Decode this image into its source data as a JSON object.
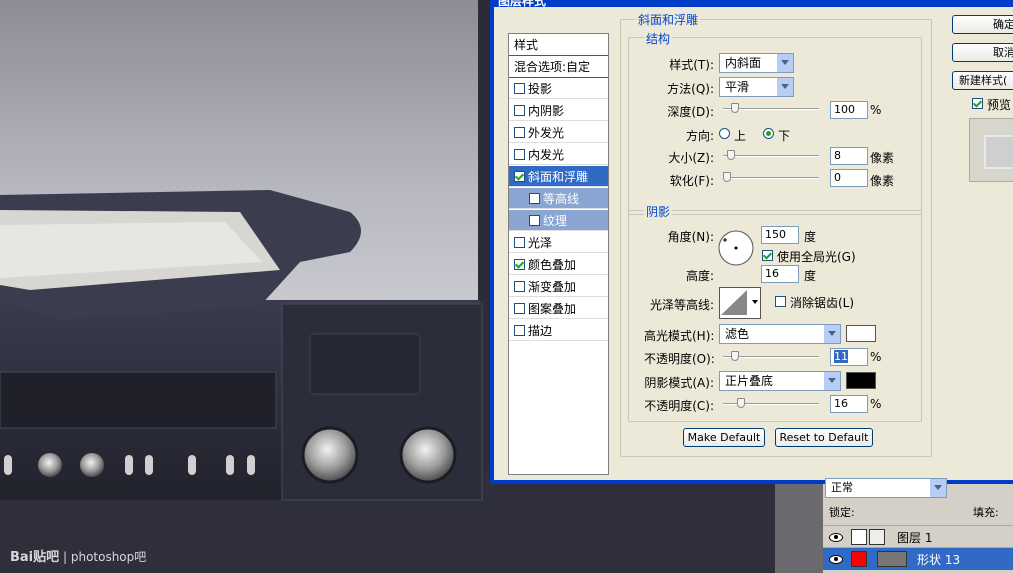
{
  "dialog": {
    "title": "图层样式",
    "list": {
      "header": "样式",
      "blend": "混合选项:自定",
      "items": [
        {
          "label": "投影",
          "checked": false
        },
        {
          "label": "内阴影",
          "checked": false
        },
        {
          "label": "外发光",
          "checked": false
        },
        {
          "label": "内发光",
          "checked": false
        },
        {
          "label": "斜面和浮雕",
          "checked": true
        },
        {
          "label": "等高线",
          "checked": false
        },
        {
          "label": "纹理",
          "checked": false
        },
        {
          "label": "光泽",
          "checked": false
        },
        {
          "label": "颜色叠加",
          "checked": true
        },
        {
          "label": "渐变叠加",
          "checked": false
        },
        {
          "label": "图案叠加",
          "checked": false
        },
        {
          "label": "描边",
          "checked": false
        }
      ]
    },
    "section_title": "斜面和浮雕",
    "structure": {
      "label": "结构",
      "style_label": "样式(T):",
      "style_value": "内斜面",
      "technique_label": "方法(Q):",
      "technique_value": "平滑",
      "depth_label": "深度(D):",
      "depth_value": "100",
      "depth_unit": "%",
      "direction_label": "方向:",
      "dir_up": "上",
      "dir_down": "下",
      "size_label": "大小(Z):",
      "size_value": "8",
      "size_unit": "像素",
      "soften_label": "软化(F):",
      "soften_value": "0",
      "soften_unit": "像素"
    },
    "shading": {
      "label": "阴影",
      "angle_label": "角度(N):",
      "angle_value": "150",
      "angle_unit": "度",
      "global_light": "使用全局光(G)",
      "altitude_label": "高度:",
      "altitude_value": "16",
      "altitude_unit": "度",
      "gloss_label": "光泽等高线:",
      "antialias": "消除锯齿(L)",
      "highlight_label": "高光模式(H):",
      "highlight_value": "滤色",
      "highlight_opacity_label": "不透明度(O):",
      "highlight_opacity": "11",
      "highlight_unit": "%",
      "shadow_label": "阴影模式(A):",
      "shadow_value": "正片叠底",
      "shadow_opacity_label": "不透明度(C):",
      "shadow_opacity": "16",
      "shadow_unit": "%"
    },
    "make_default": "Make Default",
    "reset_default": "Reset to Default",
    "ok": "确定",
    "cancel": "取消",
    "new_style": "新建样式(",
    "preview": "预览"
  },
  "layers": {
    "mode": "正常",
    "lock_label": "锁定:",
    "fill_label": "填充:",
    "rows": [
      {
        "name": "图层 1"
      },
      {
        "name": "形状 13"
      }
    ]
  },
  "watermark": {
    "brand": "Bai",
    "brand2": "贴吧",
    "text": "| photoshop吧"
  },
  "colors": {
    "dialog_border": "#003cc8",
    "selected": "#316ac5",
    "shape_color": "#ff0000"
  }
}
